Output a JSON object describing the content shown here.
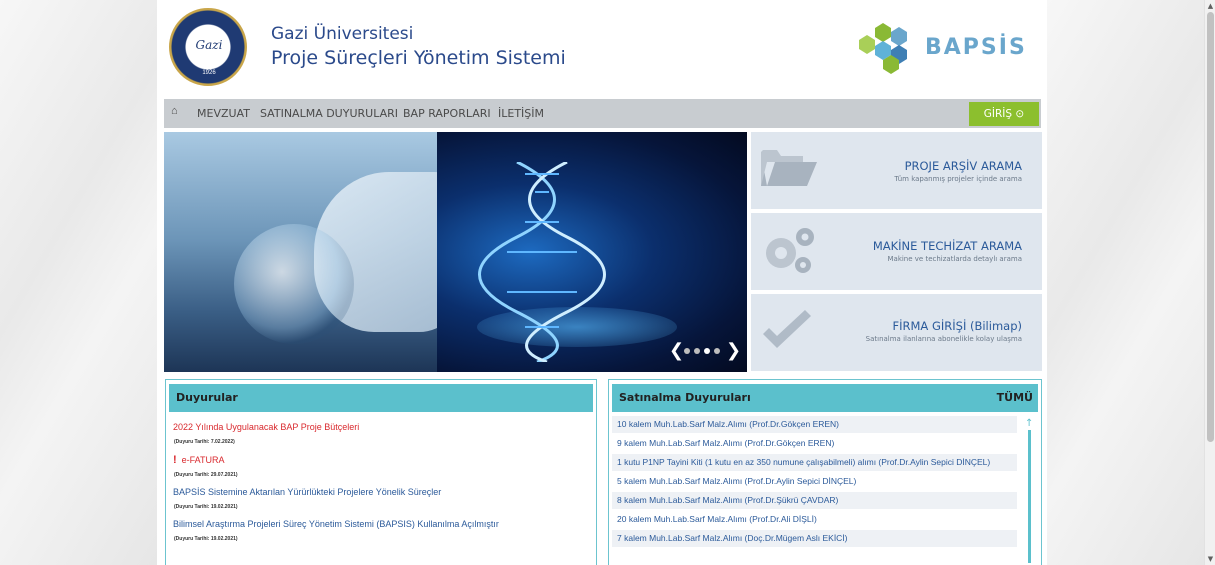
{
  "header": {
    "seal_signature": "Gazi",
    "seal_year": "1926",
    "title_line1": "Gazi Üniversitesi",
    "title_line2": "Proje Süreçleri Yönetim Sistemi",
    "brand_logo_text": "BAPSİS"
  },
  "nav": {
    "items": [
      "MEVZUAT",
      "SATINALMA DUYURULARI",
      "BAP RAPORLARI",
      "İLETİŞİM"
    ],
    "login_label": "GİRİŞ ⊙"
  },
  "slider": {
    "prev_glyph": "❮",
    "next_glyph": "❯",
    "dot_count": 4,
    "active_dot": 3
  },
  "tiles": [
    {
      "title": "PROJE ARŞİV ARAMA",
      "subtitle": "Tüm kapanmış projeler içinde arama",
      "icon": "folder-icon"
    },
    {
      "title": "MAKİNE TECHİZAT ARAMA",
      "subtitle": "Makine ve techizatlarda detaylı arama",
      "icon": "gears-icon"
    },
    {
      "title": "FİRMA GİRİŞİ (Bilimap)",
      "subtitle": "Satınalma ilanlarına abonelikle kolay ulaşma",
      "icon": "checkmark-icon"
    }
  ],
  "announcements": {
    "title": "Duyurular",
    "items": [
      {
        "text": "2022 Yılında Uygulanacak BAP Proje Bütçeleri",
        "date": "(Duyuru Tarihi: 7.02.2022)",
        "style": "red"
      },
      {
        "text": "e-FATURA",
        "date": "(Duyuru Tarihi: 29.07.2021)",
        "style": "red-bang"
      },
      {
        "text": "BAPSİS Sistemine Aktarılan Yürürlükteki Projelere Yönelik Süreçler",
        "date": "(Duyuru Tarihi: 19.02.2021)",
        "style": "blue"
      },
      {
        "text": "Bilimsel Araştırma Projeleri Süreç Yönetim Sistemi (BAPSIS) Kullanılma Açılmıştır",
        "date": "(Duyuru Tarihi: 19.02.2021)",
        "style": "blue"
      }
    ]
  },
  "procurement": {
    "title": "Satınalma Duyuruları",
    "all_label": "TÜMÜ",
    "items": [
      "10 kalem Muh.Lab.Sarf Malz.Alımı (Prof.Dr.Gökçen EREN)",
      "9 kalem Muh.Lab.Sarf Malz.Alımı (Prof.Dr.Gökçen EREN)",
      "1 kutu P1NP Tayini Kiti (1 kutu en az 350 numune çalışabilmeli) alımı (Prof.Dr.Aylin Sepici DİNÇEL)",
      "5 kalem Muh.Lab.Sarf Malz.Alımı (Prof.Dr.Aylin Sepici DİNÇEL)",
      "8 kalem Muh.Lab.Sarf Malz.Alımı (Prof.Dr.Şükrü ÇAVDAR)",
      "20 kalem Muh.Lab.Sarf Malz.Alımı (Prof.Dr.Ali DİŞLİ)",
      "7 kalem Muh.Lab.Sarf Malz.Alımı (Doç.Dr.Mügem Aslı EKİCİ)"
    ]
  }
}
